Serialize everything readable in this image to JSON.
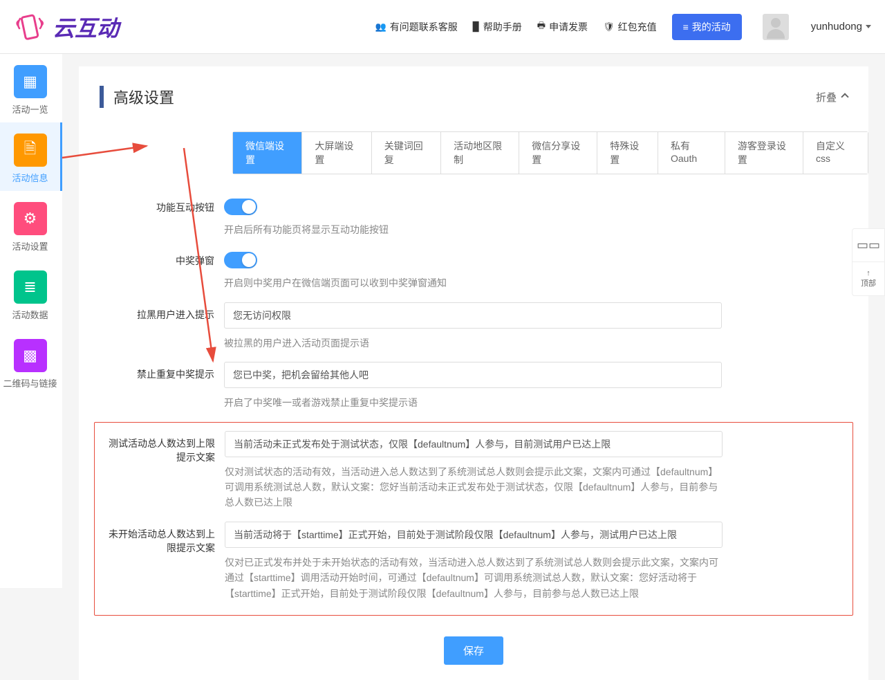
{
  "header": {
    "links": {
      "contact": "有问题联系客服",
      "help": "帮助手册",
      "invoice": "申请发票",
      "recharge": "红包充值"
    },
    "my_activities": "我的活动",
    "username": "yunhudong",
    "logo_text": "云互动"
  },
  "sidebar": {
    "items": [
      {
        "label": "活动一览",
        "icon": "grid"
      },
      {
        "label": "活动信息",
        "icon": "file"
      },
      {
        "label": "活动设置",
        "icon": "gear"
      },
      {
        "label": "活动数据",
        "icon": "db"
      },
      {
        "label": "二维码与链接",
        "icon": "qr"
      }
    ]
  },
  "section": {
    "title": "高级设置",
    "collapse": "折叠"
  },
  "tabs": [
    "微信端设置",
    "大屏端设置",
    "关键词回复",
    "活动地区限制",
    "微信分享设置",
    "特殊设置",
    "私有Oauth",
    "游客登录设置",
    "自定义css"
  ],
  "form": {
    "interactive_btn": {
      "label": "功能互动按钮",
      "help": "开启后所有功能页将显示互动功能按钮"
    },
    "prize_popup": {
      "label": "中奖弹窗",
      "help": "开启则中奖用户在微信端页面可以收到中奖弹窗通知"
    },
    "blacklist": {
      "label": "拉黑用户进入提示",
      "value": "您无访问权限",
      "help": "被拉黑的用户进入活动页面提示语"
    },
    "no_repeat": {
      "label": "禁止重复中奖提示",
      "value": "您已中奖，把机会留给其他人吧",
      "help": "开启了中奖唯一或者游戏禁止重复中奖提示语"
    },
    "test_limit": {
      "label": "测试活动总人数达到上限提示文案",
      "value": "当前活动未正式发布处于测试状态，仅限【defaultnum】人参与，目前测试用户已达上限",
      "help": "仅对测试状态的活动有效，当活动进入总人数达到了系统测试总人数则会提示此文案，文案内可通过【defaultnum】可调用系统测试总人数，默认文案：您好当前活动未正式发布处于测试状态，仅限【defaultnum】人参与，目前参与总人数已达上限"
    },
    "not_started_limit": {
      "label": "未开始活动总人数达到上限提示文案",
      "value": "当前活动将于【starttime】正式开始，目前处于测试阶段仅限【defaultnum】人参与，测试用户已达上限",
      "help": "仅对已正式发布并处于未开始状态的活动有效，当活动进入总人数达到了系统测试总人数则会提示此文案，文案内可通过【starttime】调用活动开始时间，可通过【defaultnum】可调用系统测试总人数，默认文案：您好活动将于【starttime】正式开始，目前处于测试阶段仅限【defaultnum】人参与，目前参与总人数已达上限"
    }
  },
  "buttons": {
    "save": "保存"
  },
  "float": {
    "top": "顶部"
  }
}
